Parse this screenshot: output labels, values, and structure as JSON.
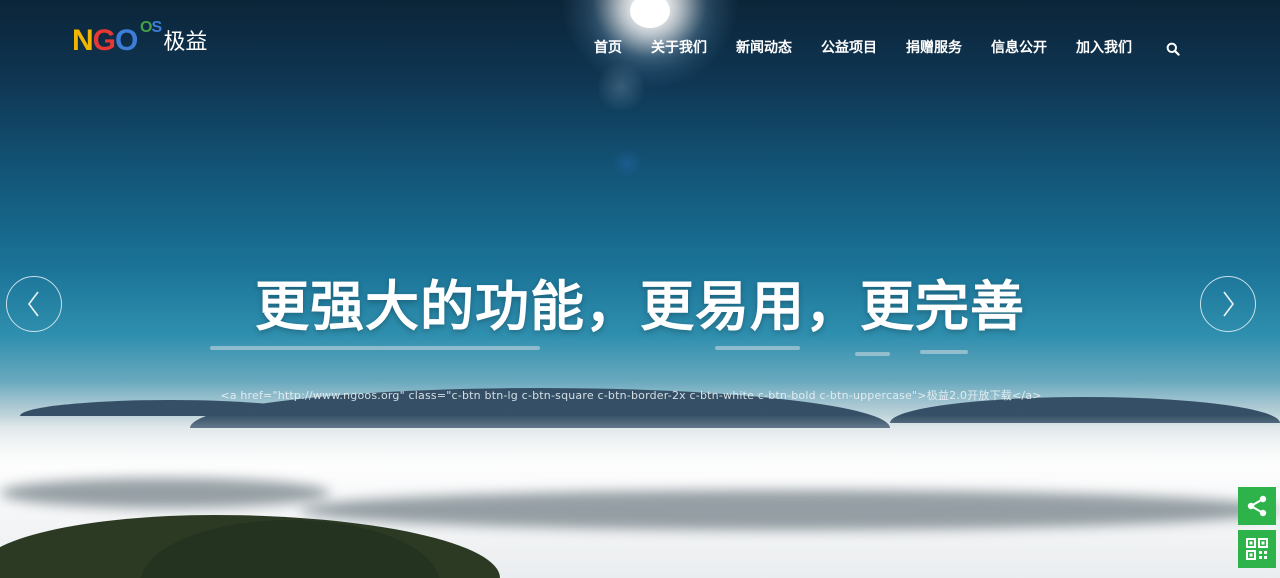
{
  "brand": {
    "logo_n": "N",
    "logo_g": "G",
    "logo_o": "O",
    "logo_o2": "O",
    "logo_s": "S",
    "name": "极益"
  },
  "nav": {
    "items": [
      "首页",
      "关于我们",
      "新闻动态",
      "公益项目",
      "捐赠服务",
      "信息公开",
      "加入我们"
    ],
    "search_icon": "search-icon"
  },
  "hero": {
    "headline": "更强大的功能，更易用，更完善",
    "raw_link_text": "<a href=\"http://www.ngoos.org\" class=\"c-btn btn-lg c-btn-square c-btn-border-2x c-btn-white c-btn-bold c-btn-uppercase\">极益2.0开放下载</a>"
  },
  "controls": {
    "prev_icon": "chevron-left-icon",
    "next_icon": "chevron-right-icon",
    "share_icon": "share-icon",
    "qrcode_icon": "qrcode-icon",
    "accent": "#2db34a"
  }
}
